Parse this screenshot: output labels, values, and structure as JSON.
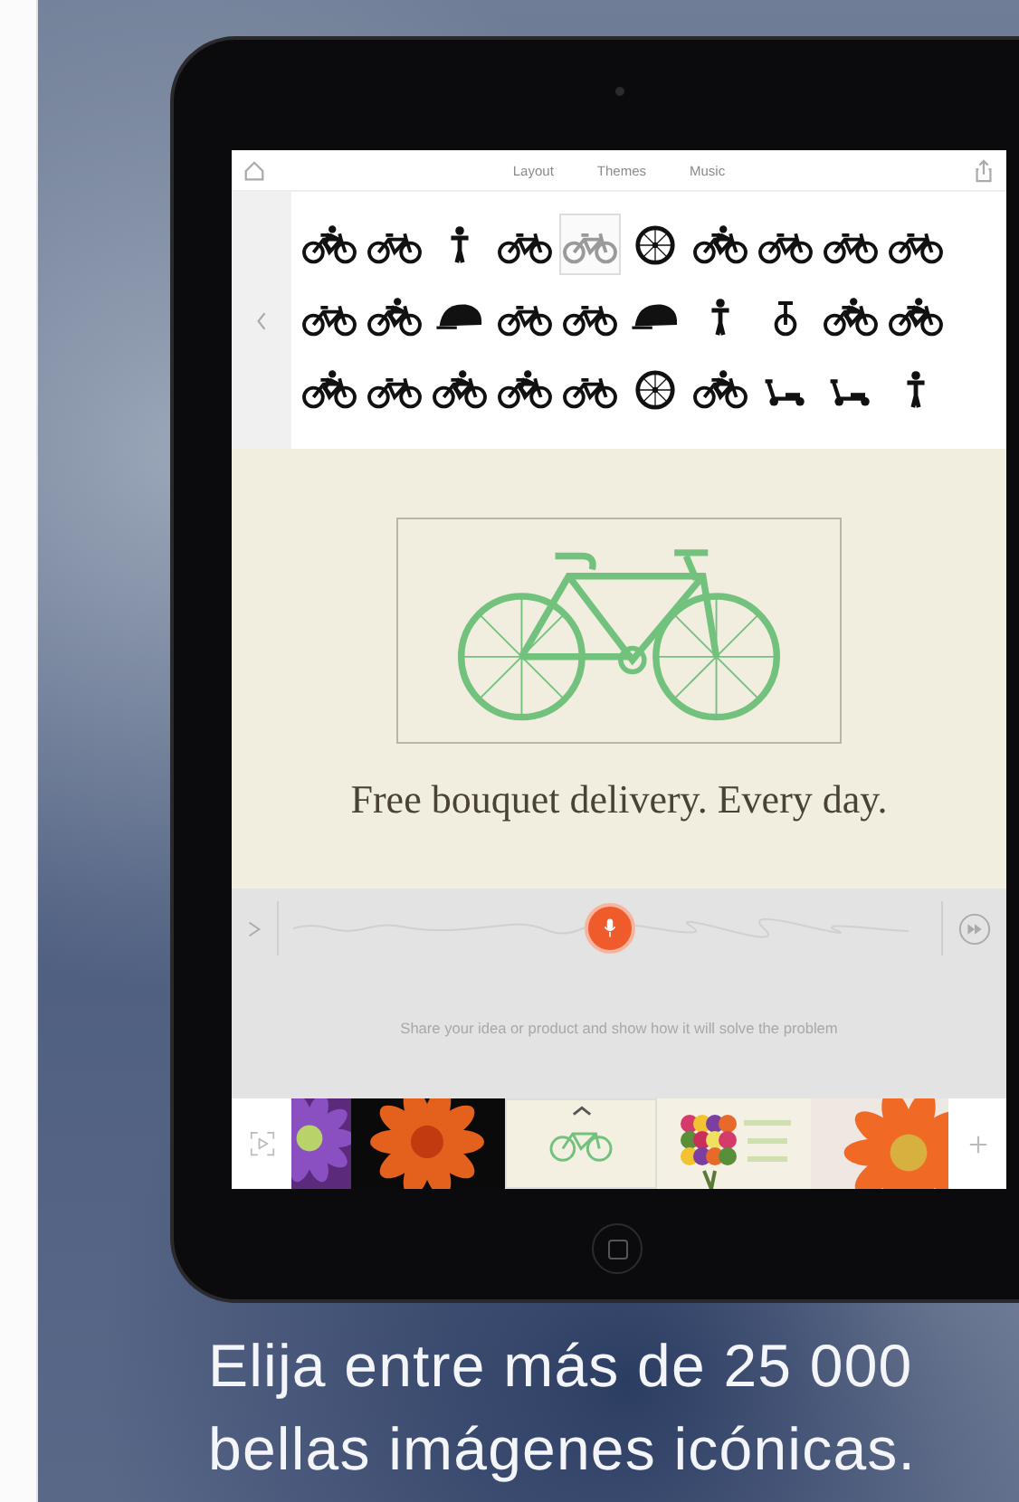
{
  "toolbar": {
    "tabs": [
      {
        "label": "Layout",
        "selected": false
      },
      {
        "label": "Themes",
        "selected": false
      },
      {
        "label": "Music",
        "selected": false
      }
    ]
  },
  "icon_picker": {
    "rows": [
      {
        "icons": [
          {
            "kind": "cyclist",
            "selected": false
          },
          {
            "kind": "bicycle",
            "selected": false
          },
          {
            "kind": "figure",
            "selected": false
          },
          {
            "kind": "bicycle",
            "selected": false
          },
          {
            "kind": "bicycle",
            "selected": true
          },
          {
            "kind": "wheel",
            "selected": false
          },
          {
            "kind": "cyclist",
            "selected": false
          },
          {
            "kind": "bicycle",
            "selected": false
          },
          {
            "kind": "bicycle",
            "selected": false
          },
          {
            "kind": "bicycle",
            "selected": false
          }
        ]
      },
      {
        "icons": [
          {
            "kind": "bicycle",
            "selected": false
          },
          {
            "kind": "cyclist",
            "selected": false
          },
          {
            "kind": "helmet",
            "selected": false
          },
          {
            "kind": "bicycle",
            "selected": false
          },
          {
            "kind": "bicycle",
            "selected": false
          },
          {
            "kind": "helmet",
            "selected": false
          },
          {
            "kind": "figure",
            "selected": false
          },
          {
            "kind": "unicycle",
            "selected": false
          },
          {
            "kind": "cyclist",
            "selected": false
          },
          {
            "kind": "cyclist",
            "selected": false
          }
        ]
      },
      {
        "icons": [
          {
            "kind": "cyclist",
            "selected": false
          },
          {
            "kind": "bicycle",
            "selected": false
          },
          {
            "kind": "cyclist",
            "selected": false
          },
          {
            "kind": "cyclist",
            "selected": false
          },
          {
            "kind": "bicycle",
            "selected": false
          },
          {
            "kind": "wheel",
            "selected": false
          },
          {
            "kind": "cyclist",
            "selected": false
          },
          {
            "kind": "scooter",
            "selected": false
          },
          {
            "kind": "scooter",
            "selected": false
          },
          {
            "kind": "figure",
            "selected": false
          }
        ]
      }
    ]
  },
  "slide": {
    "caption": "Free bouquet delivery. Every day."
  },
  "recorder": {
    "hint": "Share your idea or product and show how it will solve the problem"
  },
  "filmstrip": {
    "thumbnails": [
      {
        "kind": "picture"
      },
      {
        "kind": "picture"
      },
      {
        "kind": "slide"
      },
      {
        "kind": "picture"
      },
      {
        "kind": "picture"
      }
    ]
  },
  "caption": {
    "lines": [
      "Elija entre más de 25 000",
      "bellas imágenes icónicas."
    ]
  }
}
